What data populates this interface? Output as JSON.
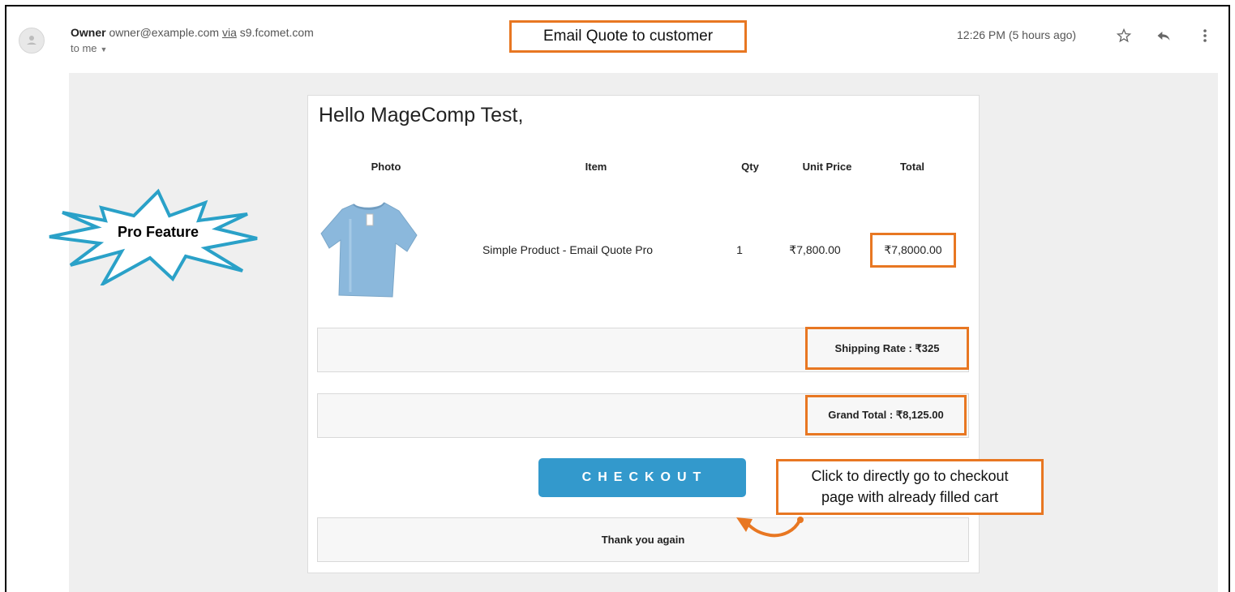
{
  "header": {
    "sender_name": "Owner",
    "sender_email": "owner@example.com",
    "via_label": "via",
    "via_domain": "s9.fcomet.com",
    "to_label": "to me",
    "chevron_icon": "chevron-down-icon",
    "timestamp": "12:26 PM (5 hours ago)",
    "icons": [
      "star-icon",
      "reply-icon",
      "more-vert-icon"
    ]
  },
  "callouts": {
    "title": "Email Quote to customer",
    "pro_feature": "Pro Feature",
    "checkout_note_line1": "Click to directly go to checkout",
    "checkout_note_line2": "page with already filled cart"
  },
  "email": {
    "greeting": "Hello MageComp Test,",
    "columns": {
      "photo": "Photo",
      "item": "Item",
      "qty": "Qty",
      "unit_price": "Unit Price",
      "total": "Total"
    },
    "row": {
      "item": "Simple Product - Email Quote Pro",
      "qty": "1",
      "unit_price": "₹7,800.00",
      "total": "₹7,8000.00"
    },
    "shipping": "Shipping Rate : ₹325",
    "grand_total": "Grand Total : ₹8,125.00",
    "checkout_label": "CHECKOUT",
    "thanks": "Thank you again"
  },
  "colors": {
    "callout_border": "#e87722",
    "checkout_button": "#3399cc",
    "burst_stroke": "#2aa1c8"
  }
}
